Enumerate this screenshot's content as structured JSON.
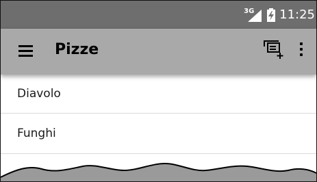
{
  "status_bar": {
    "network": "3G",
    "time": "11:25",
    "signal_icon": "signal-icon",
    "battery_icon": "battery-charging-icon"
  },
  "app_bar": {
    "menu_icon": "hamburger-menu-icon",
    "title": "Pizze",
    "add_icon": "add-to-queue-icon",
    "overflow_icon": "more-vert-icon"
  },
  "list": {
    "items": [
      {
        "label": "Diavolo"
      },
      {
        "label": "Funghi"
      }
    ]
  },
  "colors": {
    "status_bar": "#6e6e6e",
    "app_bar": "#a9a9a9",
    "background": "#ffffff",
    "divider": "#dadada"
  }
}
